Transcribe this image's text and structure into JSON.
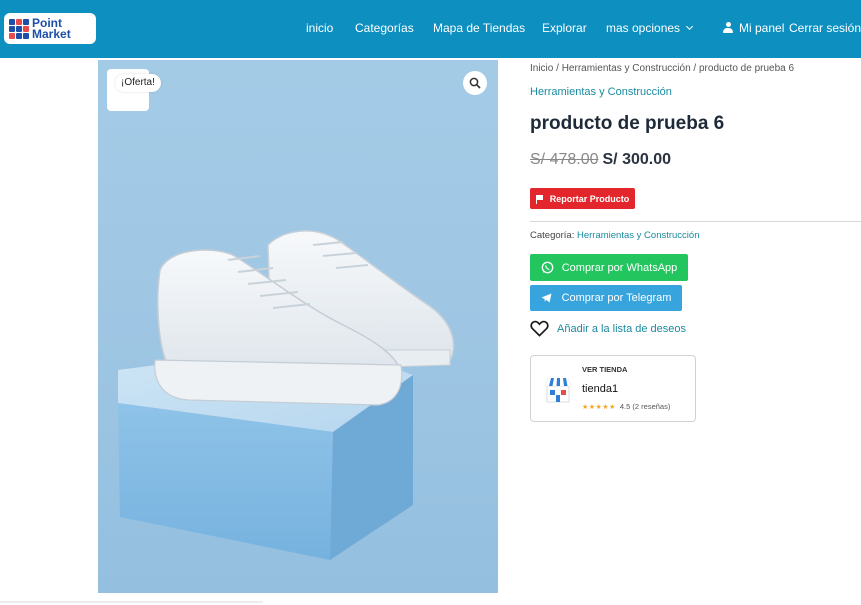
{
  "header": {
    "logo_line1": "Point",
    "logo_line2": "Market",
    "nav": [
      {
        "label": "inicio"
      },
      {
        "label": "Categorías"
      },
      {
        "label": "Mapa de Tiendas"
      },
      {
        "label": "Explorar"
      },
      {
        "label": "mas opciones"
      }
    ],
    "panel_label": "Mi panel",
    "logout_label": "Cerrar sesión"
  },
  "product": {
    "sale_badge": "¡Oferta!",
    "breadcrumb": {
      "home": "Inicio",
      "sep": " / ",
      "category": "Herramientas y Construcción",
      "current": "producto de prueba 6"
    },
    "category_link": "Herramientas y Construcción",
    "title": "producto de prueba 6",
    "price_old": "S/ 478.00",
    "price_new": "S/ 300.00",
    "report_label": "Reportar Producto",
    "category_prefix": "Categoría: ",
    "category_value": "Herramientas y Construcción",
    "whatsapp_label": "Comprar por WhatsApp",
    "telegram_label": "Comprar por Telegram",
    "wishlist_label": "Añadir a la lista de deseos"
  },
  "store": {
    "label": "VER TIENDA",
    "name": "tienda1",
    "stars": "★★★★★",
    "rating_text": "4.5 (2 reseñas)"
  },
  "colors": {
    "header": "#0d8fc0",
    "accent_link": "#1a8aa0",
    "report": "#e2262c",
    "whatsapp": "#22c55e",
    "telegram": "#38a4de"
  },
  "icons": [
    "user-icon",
    "chevron-down-icon",
    "search-icon",
    "flag-icon",
    "whatsapp-icon",
    "telegram-icon",
    "heart-icon",
    "store-icon"
  ]
}
